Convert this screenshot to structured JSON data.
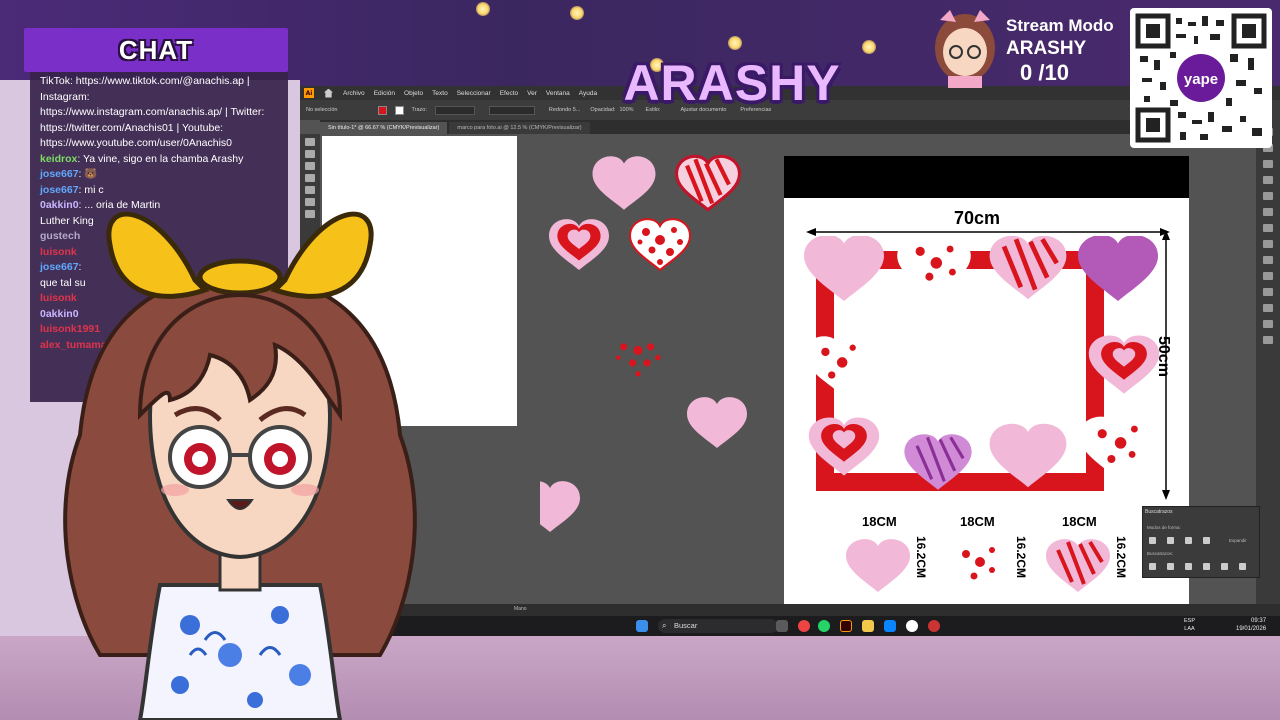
{
  "chat": {
    "header": "CHAT",
    "lines": [
      {
        "user": "",
        "text": "TikTok: https://www.tiktok.com/@anachis.ap |"
      },
      {
        "user": "",
        "text": "Instagram:"
      },
      {
        "user": "",
        "text": "https://www.instagram.com/anachis.ap/ | Twitter:"
      },
      {
        "user": "",
        "text": "https://twitter.com/Anachis01 | Youtube:"
      },
      {
        "user": "",
        "text": "https://www.youtube.com/user/0Anachis0"
      },
      {
        "user": "keidrox",
        "user_color": "#7cdc63",
        "text": ": Ya vine, sigo en la chamba Arashy"
      },
      {
        "user": "jose667",
        "user_color": "#5fa8ff",
        "text": ": 🐻"
      },
      {
        "user": "jose667",
        "user_color": "#5fa8ff",
        "text": ": mi c"
      },
      {
        "user": "0akkin0",
        "user_color": "#c9b6ff",
        "text": ": ... oria de Martin"
      },
      {
        "user": "",
        "text": "Luther King"
      },
      {
        "user": "gustech",
        "user_color": "#b6a8c9",
        "text": ""
      },
      {
        "user": "luisonk",
        "user_color": "#e0334a",
        "text": ""
      },
      {
        "user": "jose667",
        "user_color": "#5fa8ff",
        "text": ":"
      },
      {
        "user": "",
        "text": "que tal su"
      },
      {
        "user": "luisonk",
        "user_color": "#e0334a",
        "text": ""
      },
      {
        "user": "0akkin0",
        "user_color": "#c9b6ff",
        "text": ""
      },
      {
        "user": "luisonk1991",
        "user_color": "#e0334a",
        "text": ""
      },
      {
        "user": "alex_tumama",
        "user_color": "#e0334a",
        "text": ""
      }
    ]
  },
  "overlay": {
    "logo": "ARASHY",
    "stream_title": "Stream Modo",
    "stream_name": "ARASHY",
    "counter": "0 /10",
    "qr_brand": "yape"
  },
  "illustrator": {
    "menu": [
      "Archivo",
      "Edición",
      "Objeto",
      "Texto",
      "Seleccionar",
      "Efecto",
      "Ver",
      "Ventana",
      "Ayuda"
    ],
    "selection_status": "No selección",
    "stroke_label": "Trazo:",
    "brush_label": "Redondo 5...",
    "opacity_label": "Opacidad:",
    "opacity_value": "100%",
    "style_label": "Estilo:",
    "doc_settings": "Ajustar documento",
    "prefs": "Preferencias",
    "tabs": [
      {
        "label": "Sin título-1* @ 66.67 % (CMYK/Previsualizar)",
        "active": true
      },
      {
        "label": "marco para foto.ai @ 12.5 % (CMYK/Previsualizar)",
        "active": false
      }
    ],
    "status_tool": "Mano",
    "fill_color": "#d8141c",
    "pathfinder": {
      "title": "Buscatrazos",
      "shape_modes": "Modos de forma:",
      "pathfinders": "Buscatrazos:",
      "expand": "Expandir"
    }
  },
  "reference": {
    "width_label": "70cm",
    "height_label": "50cm",
    "piece_labels": [
      "18CM",
      "18CM",
      "18CM"
    ],
    "piece_height_labels": [
      "16.2CM",
      "16.2CM",
      "16.2CM"
    ]
  },
  "taskbar": {
    "search": "Buscar",
    "lang_1": "ESP",
    "lang_2": "LAA",
    "time": "09:37",
    "date": "19/01/2026"
  },
  "colors": {
    "heart_pink": "#f2b8d8",
    "heart_red": "#d8141c",
    "heart_purple": "#b35ab8",
    "chat_purple": "#7a2fc9"
  }
}
